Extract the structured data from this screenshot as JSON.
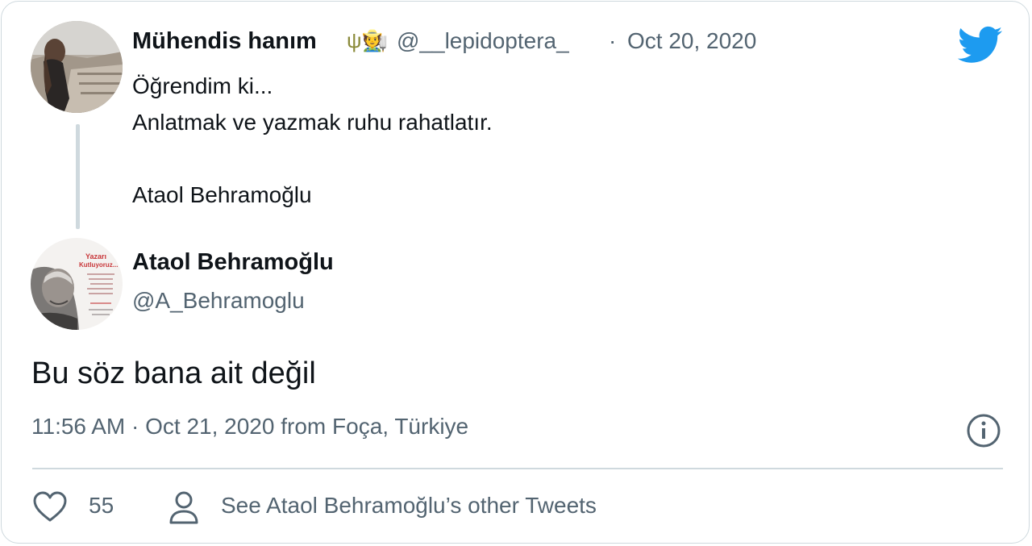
{
  "quoted_tweet": {
    "display_name": "Mühendis hanım",
    "name_emoji": "ψ🧑‍🌾",
    "handle": "@__lepidoptera_",
    "separator": "·",
    "date": "Oct 20, 2020",
    "lines": [
      "Öğrendim ki...",
      "Anlatmak ve yazmak ruhu rahatlatır.",
      "",
      "Ataol Behramoğlu"
    ]
  },
  "reply_tweet": {
    "display_name": "Ataol Behramoğlu",
    "handle": "@A_Behramoglu",
    "text": "Bu söz bana ait değil",
    "time": "11:56 AM",
    "separator": "·",
    "date": "Oct 21, 2020",
    "from_label": "from",
    "location": "Foça, Türkiye",
    "avatar_text_line1": "Yazarı",
    "avatar_text_line2": "Kutluyoruz..."
  },
  "actions": {
    "like_count": "55",
    "see_other_tweets_label": "See Ataol Behramoğlu’s other Tweets"
  },
  "icons": {
    "brand": "twitter-bird-icon",
    "info": "info-icon",
    "like": "heart-icon",
    "profile": "person-icon"
  },
  "colors": {
    "twitter_blue": "#1d9bf0",
    "text_primary": "#0f1419",
    "text_secondary": "#536471",
    "border": "#cfd9de"
  }
}
